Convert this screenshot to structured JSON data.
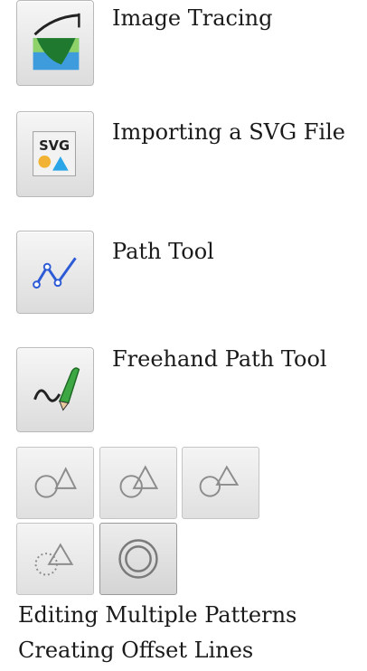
{
  "tools": [
    {
      "label": "Image Tracing",
      "icon": "image-tracing-icon"
    },
    {
      "label": "Importing a SVG File",
      "icon": "svg-file-icon",
      "icon_text": "SVG"
    },
    {
      "label": "Path Tool",
      "icon": "path-tool-icon"
    },
    {
      "label": "Freehand Path Tool",
      "icon": "freehand-path-icon"
    }
  ],
  "pattern_buttons": [
    {
      "icon": "circle-triangle-separate-icon"
    },
    {
      "icon": "circle-triangle-overlap-icon"
    },
    {
      "icon": "circle-triangle-touching-icon"
    },
    {
      "icon": "circle-triangle-dotted-icon"
    },
    {
      "icon": "offset-circle-icon"
    }
  ],
  "captions": {
    "multiple_patterns": "Editing Multiple Patterns",
    "offset_lines": "Creating Offset Lines"
  },
  "colors": {
    "green": "#2f8a3a",
    "blue": "#2a7fd0",
    "icon_gray": "#8c8c8c"
  }
}
